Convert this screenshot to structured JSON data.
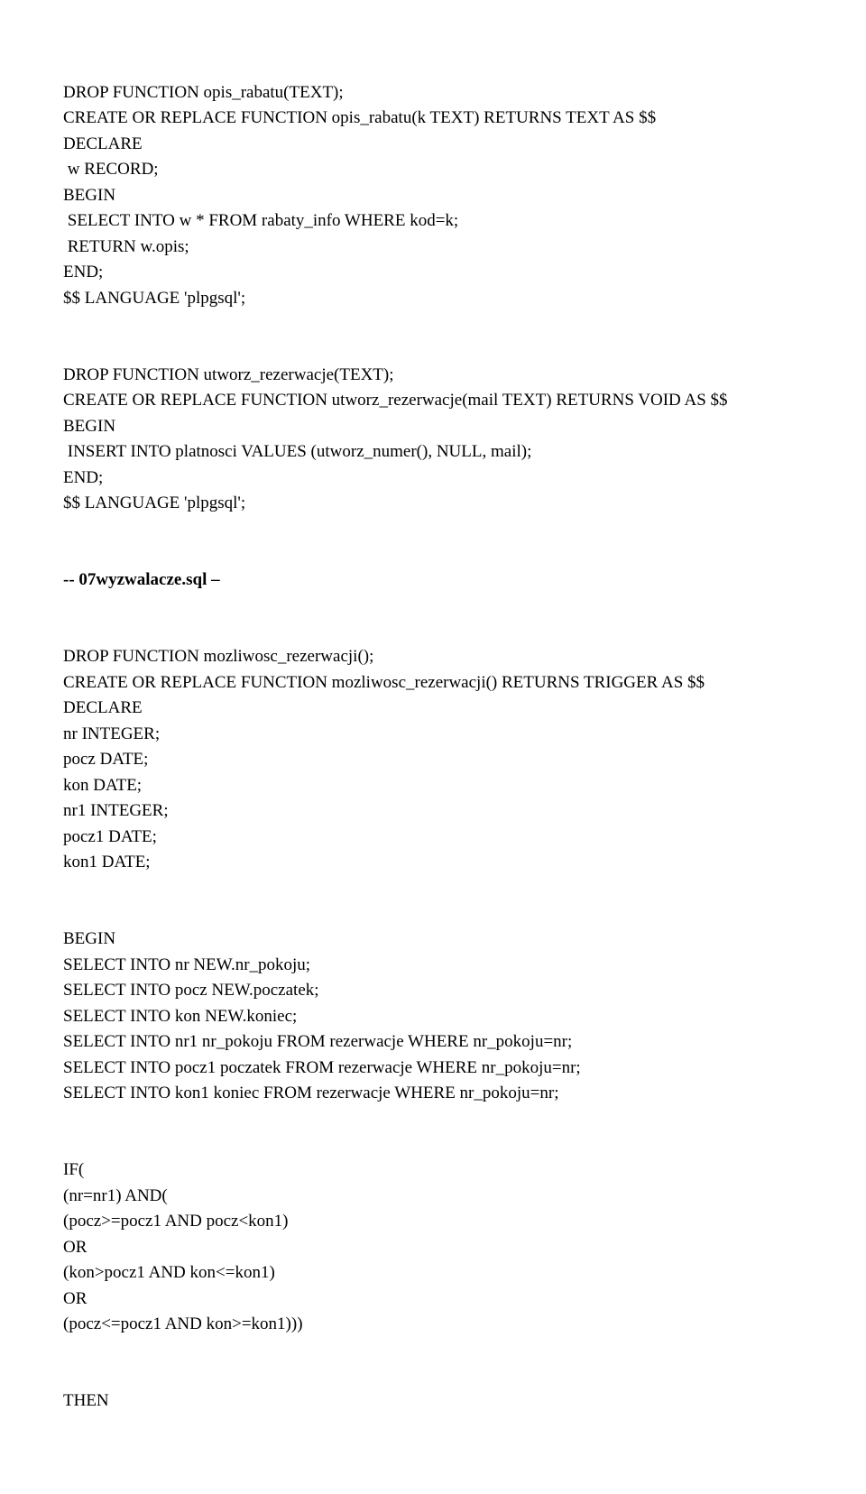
{
  "block1": {
    "l1": "DROP FUNCTION opis_rabatu(TEXT);",
    "l2": "CREATE OR REPLACE FUNCTION opis_rabatu(k TEXT) RETURNS TEXT AS $$",
    "l3": "DECLARE",
    "l4": " w RECORD;",
    "l5": "BEGIN",
    "l6": " SELECT INTO w * FROM rabaty_info WHERE kod=k;",
    "l7": " RETURN w.opis;",
    "l8": "END;",
    "l9": "$$ LANGUAGE 'plpgsql';"
  },
  "block2": {
    "l1": "DROP FUNCTION utworz_rezerwacje(TEXT);",
    "l2": "CREATE OR REPLACE FUNCTION utworz_rezerwacje(mail TEXT) RETURNS VOID AS $$",
    "l3": "BEGIN",
    "l4": " INSERT INTO platnosci VALUES (utworz_numer(), NULL, mail);",
    "l5": "END;",
    "l6": "$$ LANGUAGE 'plpgsql';"
  },
  "heading": "-- 07wyzwalacze.sql –",
  "block3": {
    "l1": "DROP FUNCTION mozliwosc_rezerwacji();",
    "l2": "CREATE OR REPLACE FUNCTION mozliwosc_rezerwacji() RETURNS TRIGGER AS $$",
    "l3": "DECLARE",
    "l4": "nr INTEGER;",
    "l5": "pocz DATE;",
    "l6": "kon DATE;",
    "l7": "nr1 INTEGER;",
    "l8": "pocz1 DATE;",
    "l9": "kon1 DATE;"
  },
  "block4": {
    "l1": "BEGIN",
    "l2": "SELECT INTO nr NEW.nr_pokoju;",
    "l3": "SELECT INTO pocz NEW.poczatek;",
    "l4": "SELECT INTO kon NEW.koniec;",
    "l5": "SELECT INTO nr1 nr_pokoju FROM rezerwacje WHERE nr_pokoju=nr;",
    "l6": "SELECT INTO pocz1 poczatek FROM rezerwacje WHERE nr_pokoju=nr;",
    "l7": "SELECT INTO kon1 koniec FROM rezerwacje WHERE nr_pokoju=nr;"
  },
  "block5": {
    "l1": "IF(",
    "l2": "(nr=nr1) AND(",
    "l3": "(pocz>=pocz1 AND pocz<kon1)",
    "l4": "OR",
    "l5": "(kon>pocz1 AND kon<=kon1)",
    "l6": "OR",
    "l7": "(pocz<=pocz1 AND kon>=kon1)))"
  },
  "block6": {
    "l1": "THEN"
  }
}
